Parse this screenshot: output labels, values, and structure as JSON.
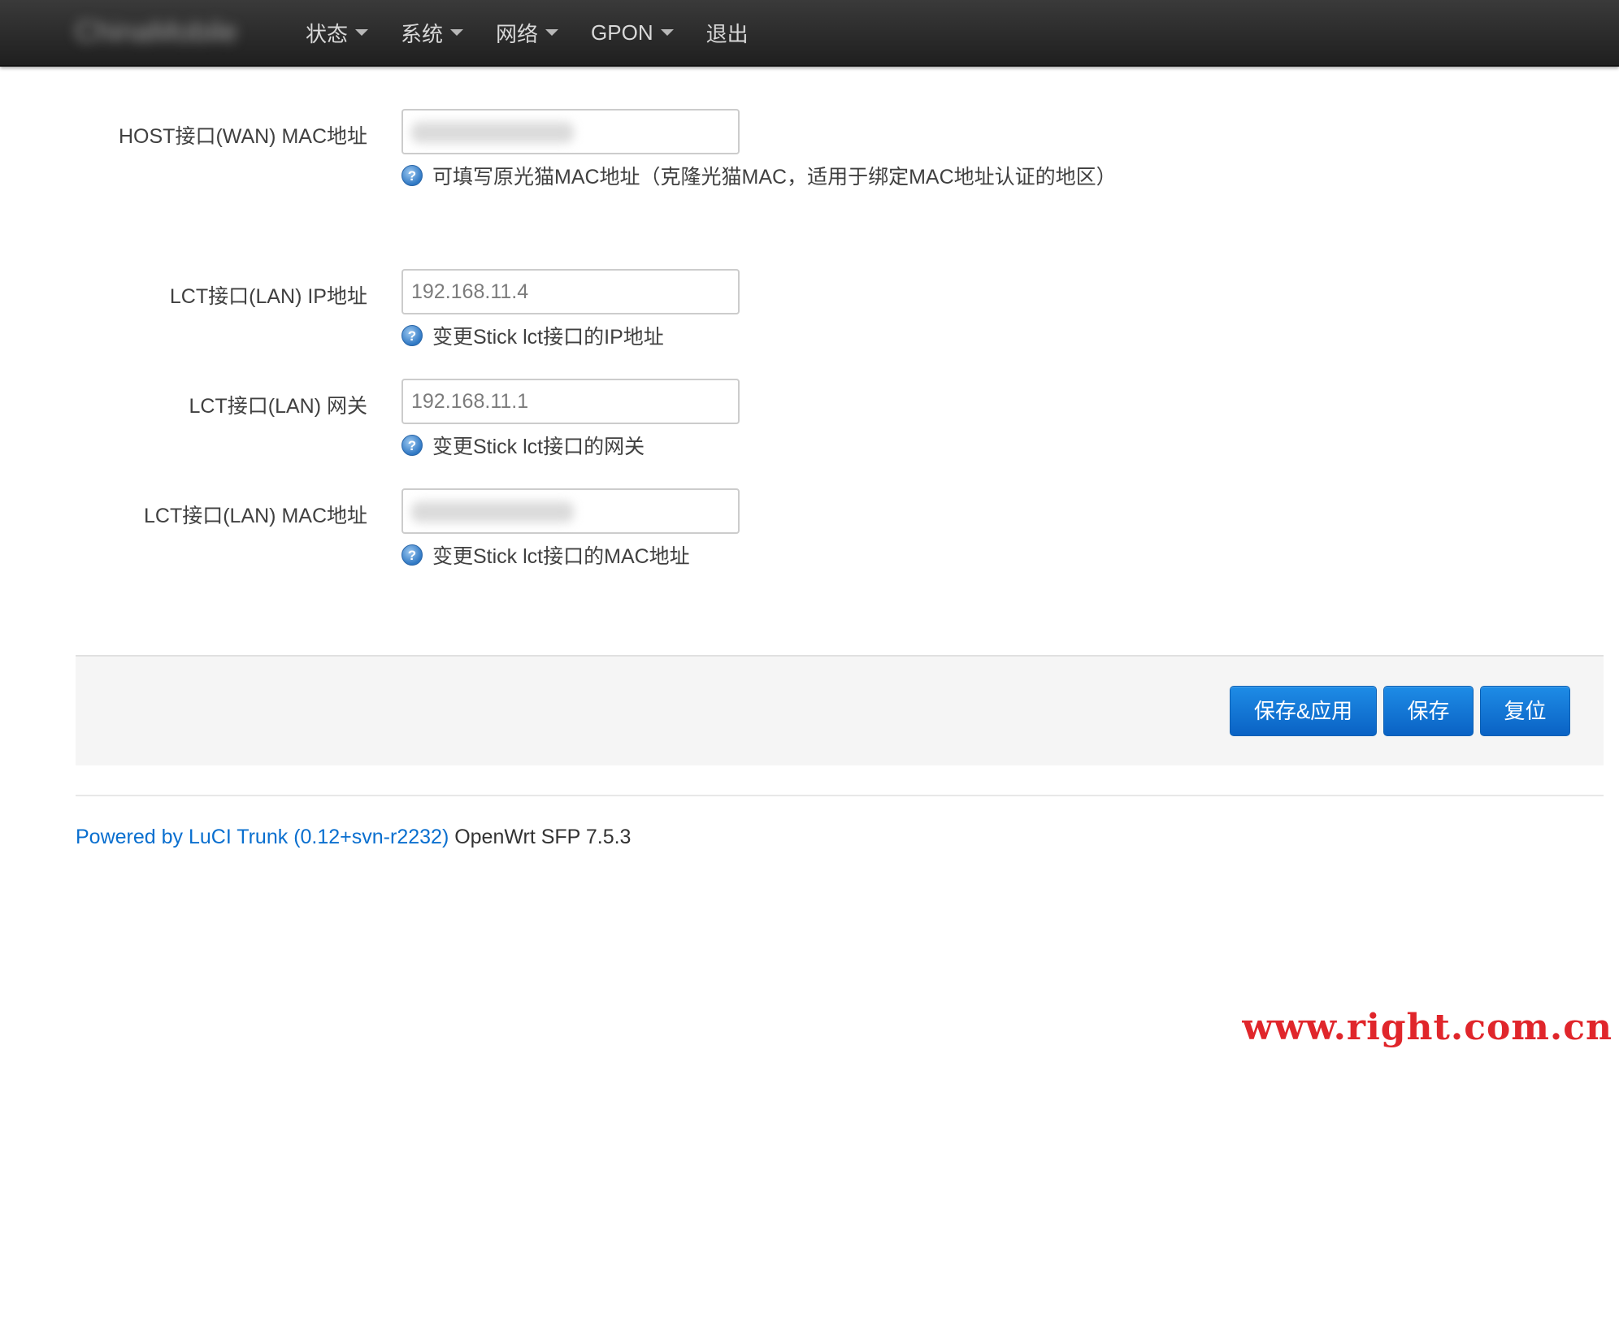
{
  "navbar": {
    "brand": "ChinaMobile",
    "items": [
      {
        "label": "状态",
        "has_dropdown": true
      },
      {
        "label": "系统",
        "has_dropdown": true
      },
      {
        "label": "网络",
        "has_dropdown": true
      },
      {
        "label": "GPON",
        "has_dropdown": true
      },
      {
        "label": "退出",
        "has_dropdown": false
      }
    ]
  },
  "form": {
    "host_wan_mac": {
      "label": "HOST接口(WAN) MAC地址",
      "value": "",
      "hint": "可填写原光猫MAC地址（克隆光猫MAC，适用于绑定MAC地址认证的地区）"
    },
    "lct_lan_ip": {
      "label": "LCT接口(LAN) IP地址",
      "value": "192.168.11.4",
      "hint": "变更Stick lct接口的IP地址"
    },
    "lct_lan_gateway": {
      "label": "LCT接口(LAN) 网关",
      "value": "192.168.11.1",
      "hint": "变更Stick lct接口的网关"
    },
    "lct_lan_mac": {
      "label": "LCT接口(LAN) MAC地址",
      "value": "",
      "hint": "变更Stick lct接口的MAC地址"
    }
  },
  "actions": {
    "save_apply": "保存&应用",
    "save": "保存",
    "reset": "复位"
  },
  "footer": {
    "link_text": "Powered by LuCI Trunk (0.12+svn-r2232)",
    "version_text": " OpenWrt SFP 7.5.3"
  },
  "watermark": "www.right.com.cn",
  "icons": {
    "help": "help-icon",
    "dropdown": "caret-down-icon"
  },
  "colors": {
    "navbar": "#2b2b2b",
    "primary_button": "#1a7fdd",
    "link": "#0a6fcf",
    "watermark": "#e0262b"
  }
}
